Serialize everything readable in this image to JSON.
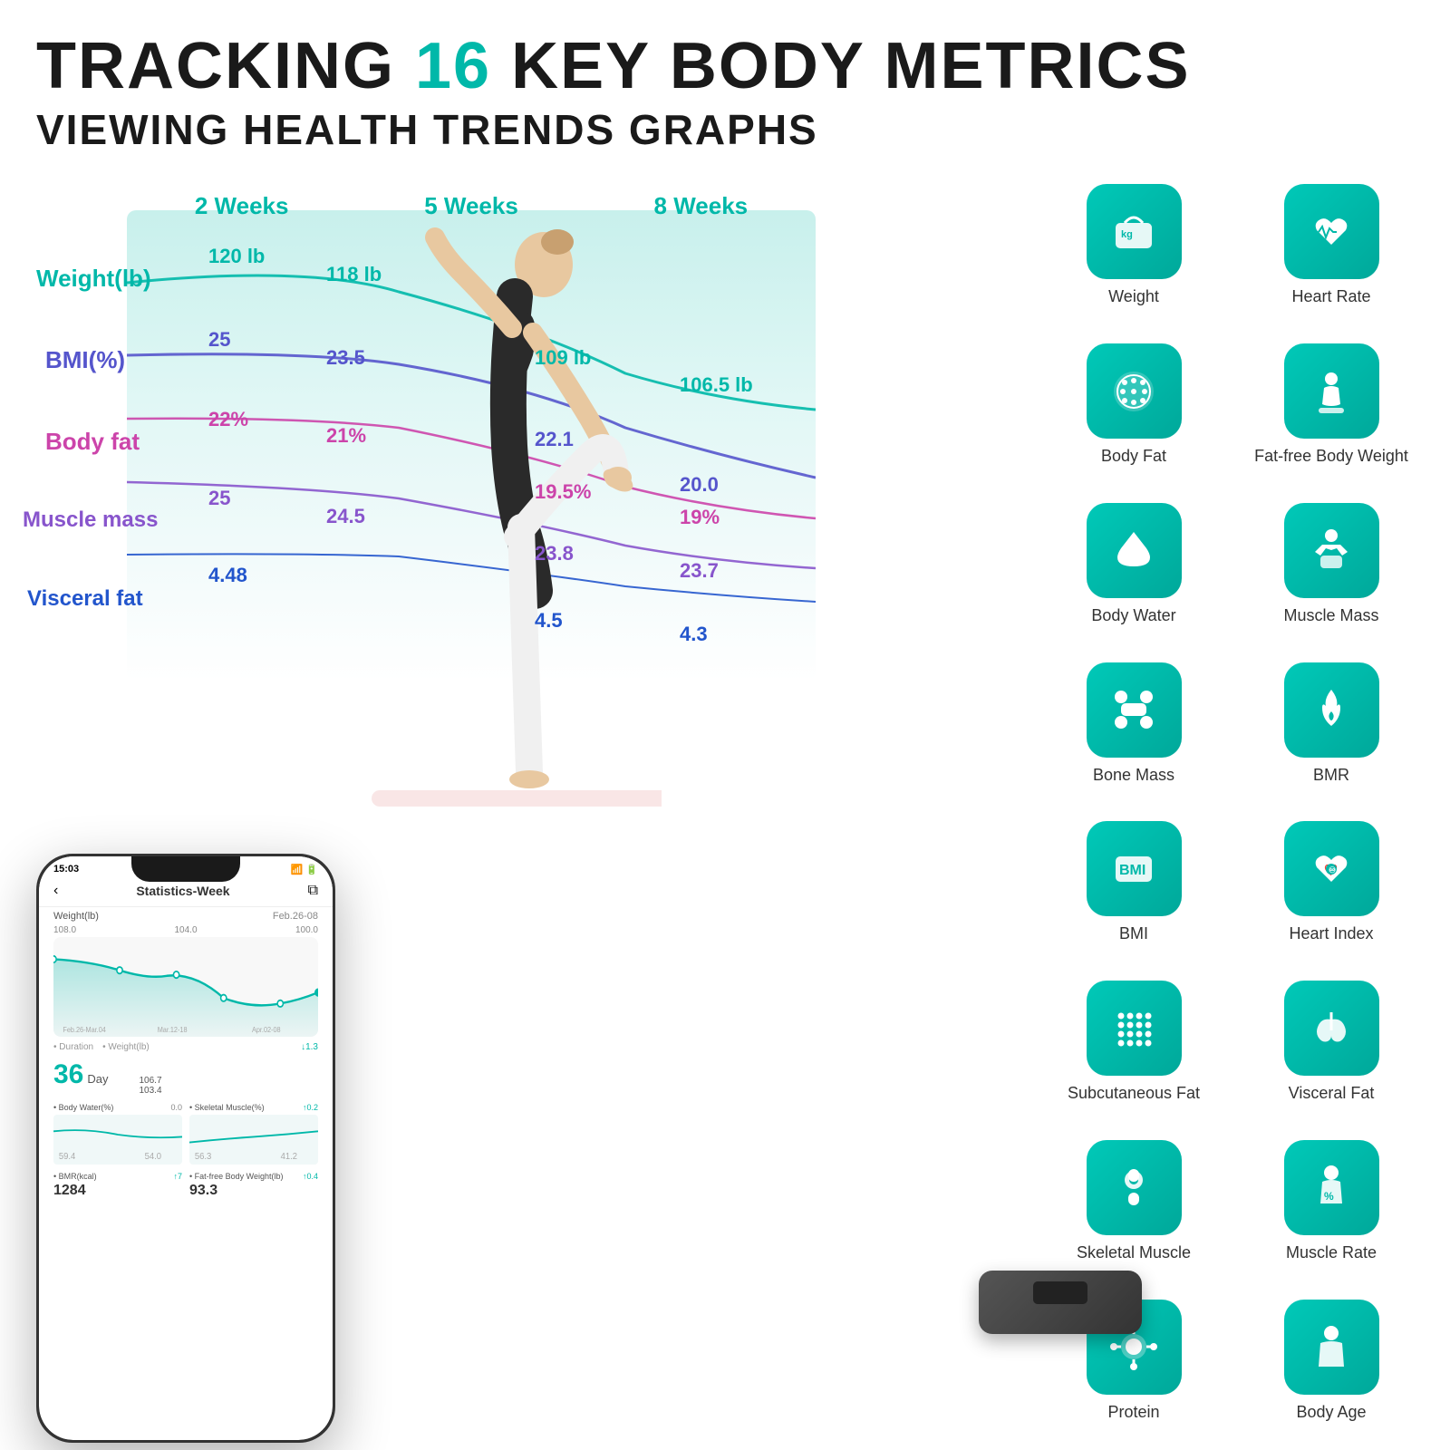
{
  "header": {
    "line1_pre": "TRACKING ",
    "line1_number": "16",
    "line1_post": " KEY BODY METRICS",
    "line2": "VIEWING HEALTH TRENDS GRAPHS"
  },
  "chart": {
    "week_labels": [
      "2 Weeks",
      "5 Weeks",
      "8 Weeks"
    ],
    "metrics": [
      {
        "name": "Weight(lb)",
        "color": "#00b8a9",
        "values": [
          "120 lb",
          "118 lb",
          "109 lb",
          "106.5 lb"
        ]
      },
      {
        "name": "BMI(%)",
        "color": "#5555cc",
        "values": [
          "25",
          "23.5",
          "22.1",
          "20.0"
        ]
      },
      {
        "name": "Body fat",
        "color": "#cc44aa",
        "values": [
          "22%",
          "21%",
          "19.5%",
          "19%"
        ]
      },
      {
        "name": "Muscle mass",
        "color": "#8855cc",
        "values": [
          "25",
          "24.5",
          "23.8",
          "23.7"
        ]
      },
      {
        "name": "Visceral fat",
        "color": "#2255cc",
        "values": [
          "4.48",
          "4.5",
          "4.3"
        ]
      }
    ]
  },
  "phone": {
    "time": "15:03",
    "title": "Statistics-Week",
    "weight_label": "Weight(lb)",
    "date_range": "Feb.26-08",
    "chart_dates": [
      "Feb.26-Mar.04",
      "Mar.12-18",
      "Apr.02-08"
    ],
    "chart_values": [
      "108.0",
      "104.0",
      "100.0"
    ],
    "duration_label": "Duration",
    "duration_value": "36",
    "duration_unit": "Day",
    "weight_stat_label": "Weight(lb)",
    "weight_stat_change": "↓1.3",
    "weight_values": [
      "106.7",
      "103.4"
    ],
    "body_water_label": "Body Water(%)",
    "body_water_change": "0.0",
    "body_water_values": [
      "59.4",
      "54.0"
    ],
    "skeletal_label": "Skeletal Muscle(%)",
    "skeletal_change": "↑0.2",
    "skeletal_values": [
      "56.3",
      "41.2"
    ],
    "bmr_label": "BMR(kcal)",
    "bmr_change": "↑7",
    "bmr_value": "1284",
    "fatfree_label": "Fat-free Body Weight(lb)",
    "fatfree_change": "↑0.4",
    "fatfree_value": "93.3"
  },
  "metrics": [
    {
      "id": "weight",
      "label": "Weight",
      "icon": "kg"
    },
    {
      "id": "heart-rate",
      "label": "Heart Rate",
      "icon": "heart-wave"
    },
    {
      "id": "body-fat",
      "label": "Body Fat",
      "icon": "dots-circle"
    },
    {
      "id": "fat-free-body-weight",
      "label": "Fat-free Body\nWeight",
      "icon": "person-scale"
    },
    {
      "id": "body-water",
      "label": "Body Water",
      "icon": "droplet"
    },
    {
      "id": "muscle-mass",
      "label": "Muscle Mass",
      "icon": "muscle"
    },
    {
      "id": "bone-mass",
      "label": "Bone Mass",
      "icon": "bone"
    },
    {
      "id": "bmr",
      "label": "BMR",
      "icon": "flame"
    },
    {
      "id": "bmi",
      "label": "BMI",
      "icon": "bmi-text"
    },
    {
      "id": "heart-index",
      "label": "Heart Index",
      "icon": "heart-index"
    },
    {
      "id": "subcutaneous-fat",
      "label": "Subcutaneous\nFat",
      "icon": "dots-grid"
    },
    {
      "id": "visceral-fat",
      "label": "Visceral Fat",
      "icon": "lungs"
    },
    {
      "id": "skeletal-muscle",
      "label": "Skeletal Muscle",
      "icon": "joint"
    },
    {
      "id": "muscle-rate",
      "label": "Muscle Rate",
      "icon": "muscle-rate"
    },
    {
      "id": "protein",
      "label": "Protein",
      "icon": "protein"
    },
    {
      "id": "body-age",
      "label": "Body Age",
      "icon": "body-age"
    }
  ],
  "colors": {
    "teal": "#00b8a9",
    "dark_teal": "#009688",
    "light_bg": "#e0f7f5"
  }
}
